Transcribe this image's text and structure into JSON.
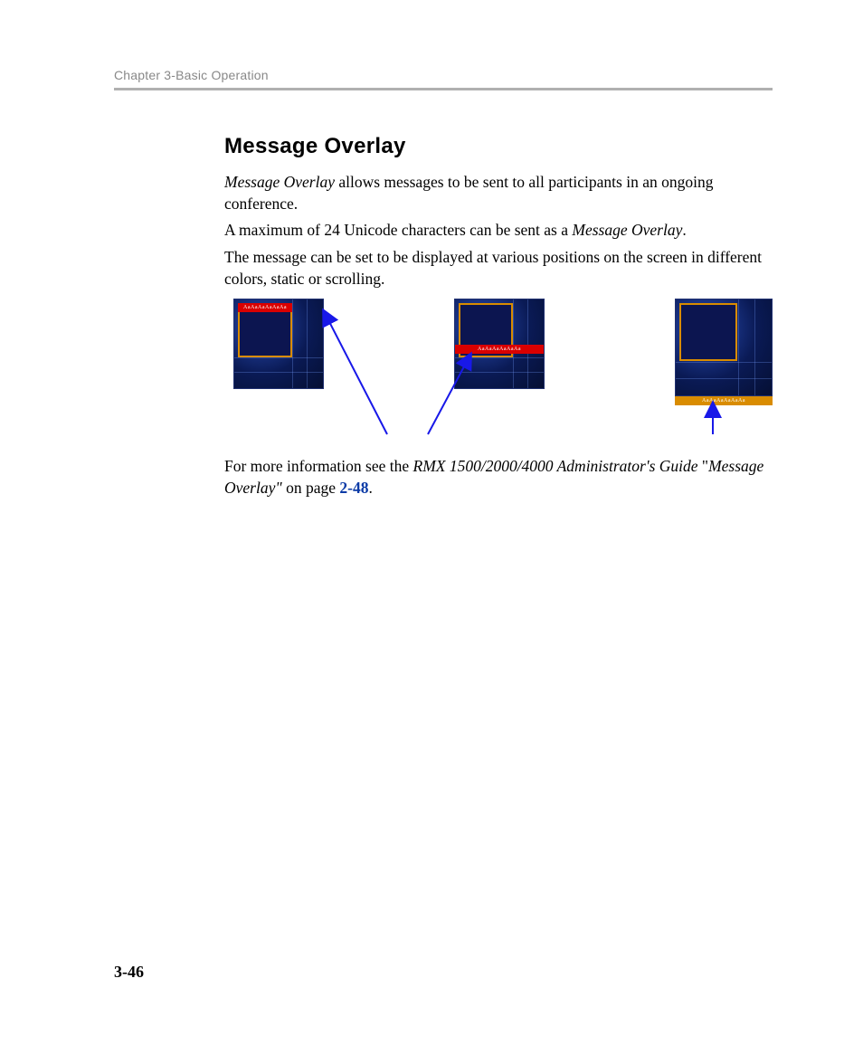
{
  "header": {
    "chapter_label": "Chapter 3-Basic Operation"
  },
  "section": {
    "title": "Message Overlay",
    "p1_lead_italic": "Message Overlay",
    "p1_rest": " allows messages to be sent to all participants in an ongoing conference.",
    "p2_a": "A maximum of 24 Unicode characters can be sent as a ",
    "p2_italic": "Message Overlay",
    "p2_b": ".",
    "p3": "The message can be set to be displayed at various positions on the screen in different colors, static or scrolling.",
    "p4_a": "For more information see the ",
    "p4_italic1": "RMX 1500/2000/4000 Administrator's Guide",
    "p4_b": " \"",
    "p4_italic2": "Message Overlay\"",
    "p4_c": " on page ",
    "p4_xref": "2-48",
    "p4_d": "."
  },
  "figures": {
    "bar_text": "AaAaAaAaAaAa"
  },
  "page_number": "3-46"
}
